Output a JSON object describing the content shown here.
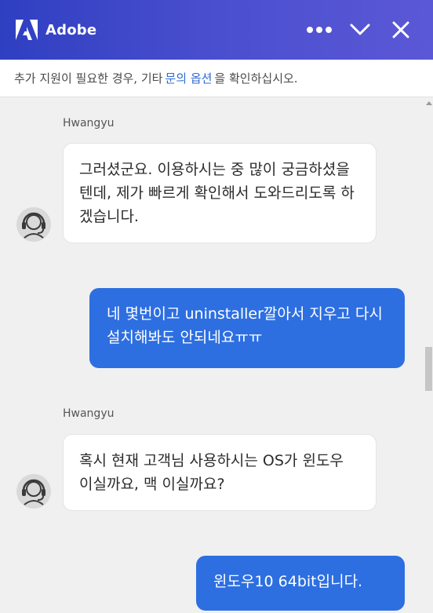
{
  "header": {
    "brand": "Adobe",
    "more_icon": "more-dots-icon",
    "minimize_icon": "chevron-down-icon",
    "close_icon": "close-icon",
    "background": "#3f47c9"
  },
  "notice": {
    "prefix": "추가 지원이 필요한 경우, 기타",
    "link": "문의 옵션",
    "suffix": "을 확인하십시오."
  },
  "messages": [
    {
      "from": "agent",
      "sender": "Hwangyu",
      "text": "그러셨군요. 이용하시는 중 많이 궁금하셨을텐데, 제가 빠르게 확인해서 도와드리도록 하겠습니다.",
      "avatar_icon": "headset-agent-icon"
    },
    {
      "from": "user",
      "text": "네 몇번이고 uninstaller깔아서 지우고 다시설치해봐도 안되네요ㅠㅠ"
    },
    {
      "from": "agent",
      "sender": "Hwangyu",
      "text": "혹시 현재 고객님 사용하시는 OS가 윈도우 이실까요, 맥 이실까요?",
      "avatar_icon": "headset-agent-icon"
    },
    {
      "from": "user",
      "text": "윈도우10 64bit입니다."
    }
  ],
  "colors": {
    "user_bubble": "#2d6fe1",
    "agent_bubble": "#ffffff",
    "chat_background": "#f0f0f0",
    "link": "#2e6bd1"
  }
}
